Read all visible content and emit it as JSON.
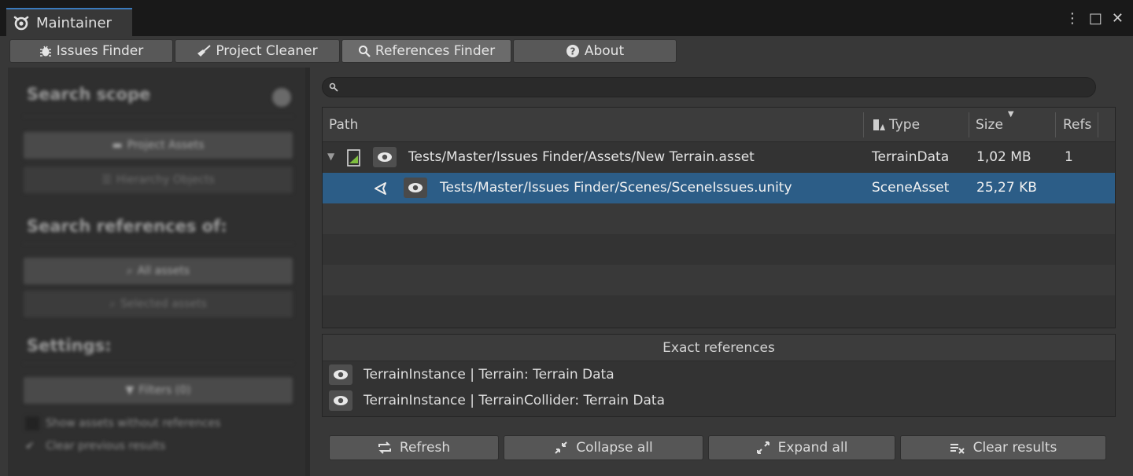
{
  "window": {
    "title": "Maintainer",
    "icon": "maintainer-logo-icon",
    "controls": {
      "menu": "⋮",
      "maximize": "□",
      "close": "✕"
    }
  },
  "tabs": [
    {
      "label": "Issues Finder",
      "icon": "bug-icon",
      "active": false
    },
    {
      "label": "Project Cleaner",
      "icon": "broom-icon",
      "active": false
    },
    {
      "label": "References Finder",
      "icon": "search-icon",
      "active": true
    },
    {
      "label": "About",
      "icon": "help-icon",
      "active": false
    }
  ],
  "left_panel": {
    "search_scope_title": "Search scope",
    "project_assets_label": "Project Assets",
    "hierarchy_objects_label": "Hierarchy Objects",
    "search_refs_title": "Search references of:",
    "all_assets_label": "All assets",
    "selected_assets_label": "Selected assets",
    "settings_title": "Settings:",
    "filters_label": "Filters (0)",
    "show_assets_label": "Show assets without references",
    "clear_previous_label": "Clear previous results"
  },
  "search": {
    "placeholder": ""
  },
  "table": {
    "columns": {
      "path": "Path",
      "type": "Type",
      "size": "Size",
      "refs": "Refs"
    },
    "rows": [
      {
        "path": "Tests/Master/Issues Finder/Assets/New Terrain.asset",
        "type": "TerrainData",
        "size": "1,02 MB",
        "refs": "1"
      },
      {
        "path": "Tests/Master/Issues Finder/Scenes/SceneIssues.unity",
        "type": "SceneAsset",
        "size": "25,27 KB",
        "refs": ""
      }
    ]
  },
  "exact": {
    "title": "Exact references",
    "items": [
      "TerrainInstance | Terrain: Terrain Data",
      "TerrainInstance | TerrainCollider: Terrain Data"
    ]
  },
  "actions": {
    "refresh": "Refresh",
    "collapse": "Collapse all",
    "expand": "Expand all",
    "clear": "Clear results"
  },
  "colors": {
    "selection": "#2c5d87",
    "accent": "#3a79bb",
    "panel": "#383838"
  }
}
